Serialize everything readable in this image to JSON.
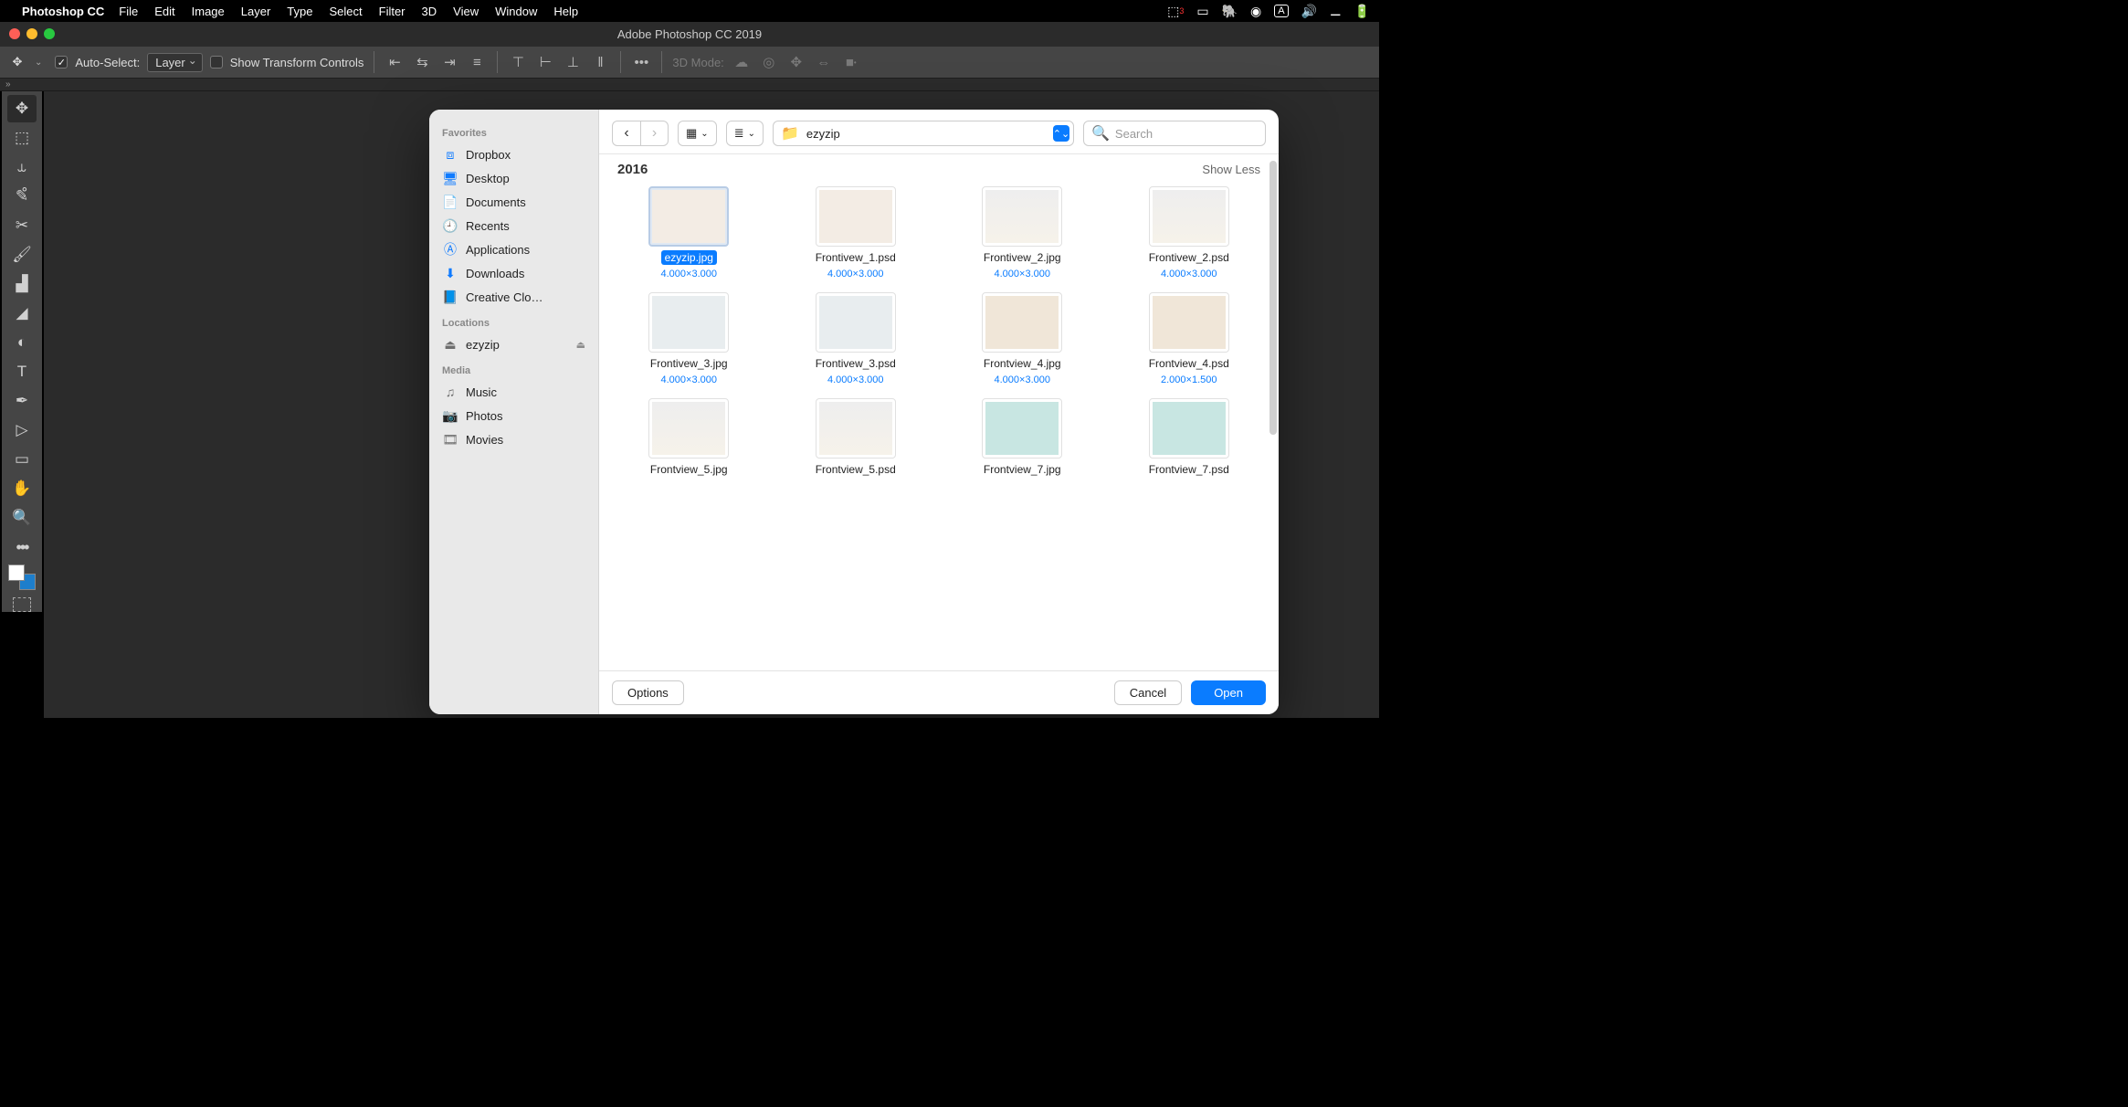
{
  "menubar": {
    "app": "Photoshop CC",
    "items": [
      "File",
      "Edit",
      "Image",
      "Layer",
      "Type",
      "Select",
      "Filter",
      "3D",
      "View",
      "Window",
      "Help"
    ]
  },
  "window": {
    "title": "Adobe Photoshop CC 2019"
  },
  "options": {
    "auto_select_label": "Auto-Select:",
    "auto_select_mode": "Layer",
    "show_transform_label": "Show Transform Controls",
    "mode3d_label": "3D Mode:"
  },
  "dialog": {
    "sidebar": {
      "favorites_label": "Favorites",
      "favorites": [
        {
          "icon": "dropbox",
          "label": "Dropbox"
        },
        {
          "icon": "desktop",
          "label": "Desktop"
        },
        {
          "icon": "doc",
          "label": "Documents"
        },
        {
          "icon": "clock",
          "label": "Recents"
        },
        {
          "icon": "apps",
          "label": "Applications"
        },
        {
          "icon": "download",
          "label": "Downloads"
        },
        {
          "icon": "cloud",
          "label": "Creative Clo…"
        }
      ],
      "locations_label": "Locations",
      "locations": [
        {
          "icon": "drive",
          "label": "ezyzip",
          "eject": true
        }
      ],
      "media_label": "Media",
      "media": [
        {
          "icon": "music",
          "label": "Music"
        },
        {
          "icon": "photos",
          "label": "Photos"
        },
        {
          "icon": "movies",
          "label": "Movies"
        }
      ]
    },
    "folder_name": "ezyzip",
    "search_placeholder": "Search",
    "section_title": "2016",
    "show_less_label": "Show Less",
    "files": [
      {
        "name": "ezyzip.jpg",
        "dims": "4.000×3.000",
        "sel": true,
        "t": "p"
      },
      {
        "name": "Frontivew_1.psd",
        "dims": "4.000×3.000",
        "sel": false,
        "t": "p"
      },
      {
        "name": "Frontivew_2.jpg",
        "dims": "4.000×3.000",
        "sel": false,
        "t": "g"
      },
      {
        "name": "Frontivew_2.psd",
        "dims": "4.000×3.000",
        "sel": false,
        "t": "g"
      },
      {
        "name": "Frontivew_3.jpg",
        "dims": "4.000×3.000",
        "sel": false,
        "t": "b"
      },
      {
        "name": "Frontivew_3.psd",
        "dims": "4.000×3.000",
        "sel": false,
        "t": "b"
      },
      {
        "name": "Frontview_4.jpg",
        "dims": "4.000×3.000",
        "sel": false,
        "t": "c"
      },
      {
        "name": "Frontview_4.psd",
        "dims": "2.000×1.500",
        "sel": false,
        "t": "c"
      },
      {
        "name": "Frontview_5.jpg",
        "dims": "",
        "sel": false,
        "t": "g"
      },
      {
        "name": "Frontview_5.psd",
        "dims": "",
        "sel": false,
        "t": "g"
      },
      {
        "name": "Frontview_7.jpg",
        "dims": "",
        "sel": false,
        "t": "t"
      },
      {
        "name": "Frontview_7.psd",
        "dims": "",
        "sel": false,
        "t": "t"
      }
    ],
    "options_btn": "Options",
    "cancel_btn": "Cancel",
    "open_btn": "Open"
  }
}
